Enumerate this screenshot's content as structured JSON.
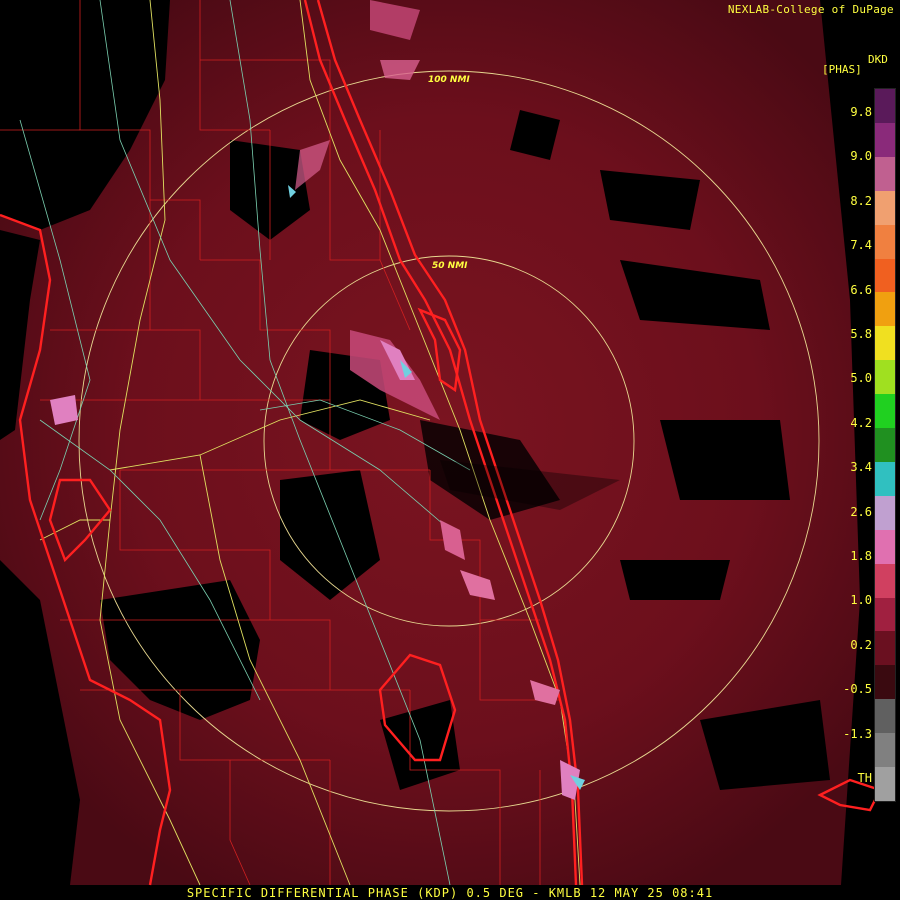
{
  "credit": "NEXLAB-College of DuPage",
  "legend": {
    "unit_top": "DKD",
    "unit_bottom": "[PHAS]",
    "ticks": [
      "9.8",
      "9.0",
      "8.2",
      "7.4",
      "6.6",
      "5.8",
      "5.0",
      "4.2",
      "3.4",
      "2.6",
      "1.8",
      "1.0",
      "0.2",
      "-0.5",
      "-1.3",
      "TH"
    ],
    "colors": [
      "#5a1a5a",
      "#8a2a7a",
      "#c06090",
      "#f0a070",
      "#f08040",
      "#f06020",
      "#f0a010",
      "#f0e020",
      "#a0e020",
      "#20d020",
      "#209020",
      "#30c0c0",
      "#c0a0d0",
      "#e070b0",
      "#d04060",
      "#a02040",
      "#6a1020",
      "#3a0a10",
      "#606060",
      "#808080",
      "#a0a0a0"
    ]
  },
  "rings": {
    "inner": "50 NMI",
    "outer": "100 NMI"
  },
  "footer": "SPECIFIC DIFFERENTIAL PHASE (KDP) 0.5 DEG - KMLB 12 MAY 25 08:41"
}
